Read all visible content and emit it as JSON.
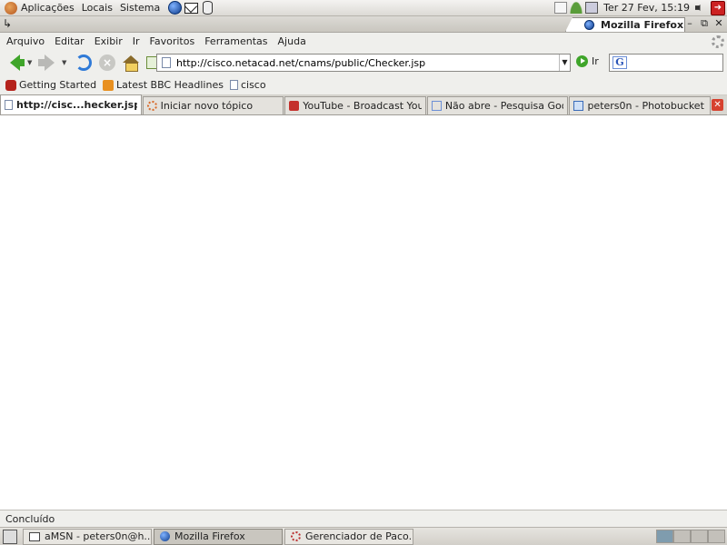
{
  "top_panel": {
    "menus": [
      "Aplicações",
      "Locais",
      "Sistema"
    ],
    "clock": "Ter 27 Fev, 15:19"
  },
  "window": {
    "title": "Mozilla Firefox",
    "wm_menu": "↳",
    "buttons": {
      "minimize": "–",
      "maximize": "⧉",
      "close": "✕"
    }
  },
  "menubar": [
    "Arquivo",
    "Editar",
    "Exibir",
    "Ir",
    "Favoritos",
    "Ferramentas",
    "Ajuda"
  ],
  "navbar": {
    "url": "http://cisco.netacad.net/cnams/public/Checker.jsp",
    "go_label": "Ir",
    "search_placeholder": ""
  },
  "bookmarks": [
    {
      "label": "Getting Started",
      "icon": "firefox-icon"
    },
    {
      "label": "Latest BBC Headlines",
      "icon": "rss-icon"
    },
    {
      "label": "cisco",
      "icon": "page-icon"
    }
  ],
  "tabs": [
    {
      "label": "http://cisc...hecker.jsp",
      "icon": "page",
      "active": true
    },
    {
      "label": "Iniciar novo tópico",
      "icon": "ubuntu",
      "active": false
    },
    {
      "label": "YouTube - Broadcast You...",
      "icon": "yt",
      "active": false
    },
    {
      "label": "Não abre - Pesquisa Goo...",
      "icon": "goog",
      "active": false
    },
    {
      "label": "peters0n - Photobucket -...",
      "icon": "pb",
      "active": false
    }
  ],
  "status": "Concluído",
  "taskbar": [
    {
      "label": "aMSN - peters0n@h...",
      "icon": "win",
      "active": false
    },
    {
      "label": "Mozilla Firefox",
      "icon": "globe-s",
      "active": true
    },
    {
      "label": "Gerenciador de Paco...",
      "icon": "gear",
      "active": false
    }
  ]
}
